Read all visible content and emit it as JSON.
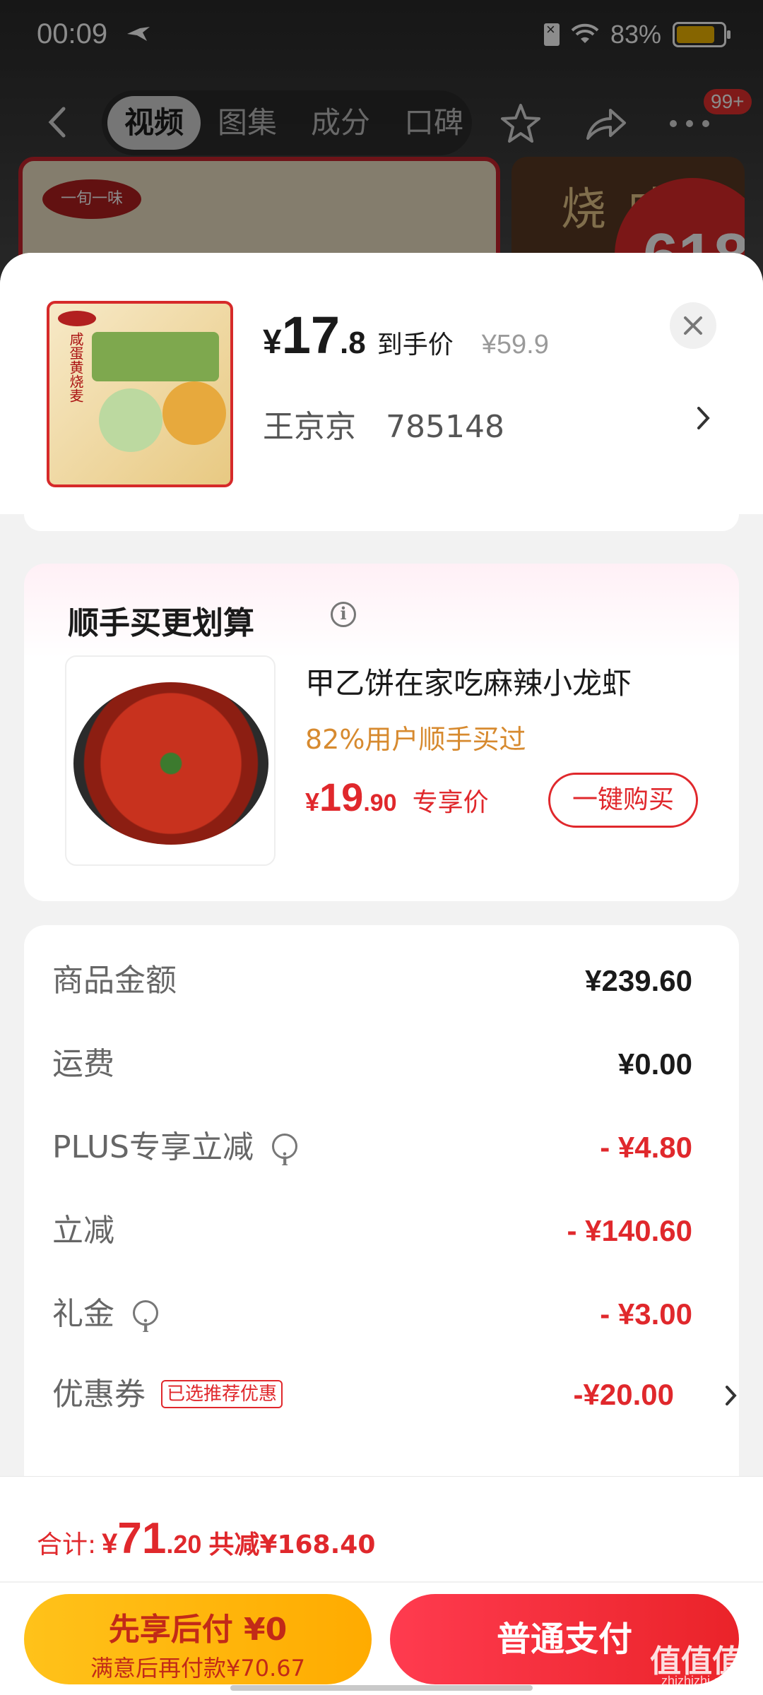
{
  "status_bar": {
    "time": "00:09",
    "battery": "83%",
    "battery_level": 0.83
  },
  "background_page": {
    "tabs": [
      {
        "label": "视频",
        "active": true
      },
      {
        "label": "图集",
        "active": false
      },
      {
        "label": "成分",
        "active": false
      },
      {
        "label": "口碑",
        "active": false
      }
    ],
    "badge": "99+",
    "promo_badge": "618",
    "side_thumb_text": "咸蛋烧",
    "logo_text": "一旬一味"
  },
  "product": {
    "price_symbol": "¥",
    "price_int": "17",
    "price_dec": ".8",
    "price_label": "到手价",
    "original_price": "¥59.9",
    "receiver_name": "王京京",
    "receiver_phone": "785148",
    "thumb_text": "咸蛋黄烧麦"
  },
  "upsell": {
    "title": "顺手买更划算",
    "item_name": "甲乙饼在家吃麻辣小龙虾",
    "social_proof": "82%用户顺手买过",
    "price_symbol": "¥",
    "price_int": "19",
    "price_dec": ".90",
    "price_label": "专享价",
    "buy_button": "一键购买"
  },
  "fees": [
    {
      "label": "商品金额",
      "value": "¥239.60",
      "color": "black",
      "info": false,
      "tag": "",
      "arrow": false
    },
    {
      "label": "运费",
      "value": "¥0.00",
      "color": "black",
      "info": false,
      "tag": "",
      "arrow": false
    },
    {
      "label": "PLUS专享立减",
      "value": "- ¥4.80",
      "color": "red",
      "info": true,
      "tag": "",
      "arrow": false
    },
    {
      "label": "立减",
      "value": "- ¥140.60",
      "color": "red",
      "info": false,
      "tag": "",
      "arrow": false
    },
    {
      "label": "礼金",
      "value": "- ¥3.00",
      "color": "red",
      "info": true,
      "tag": "",
      "arrow": false
    },
    {
      "label": "优惠券",
      "value": "-¥20.00",
      "color": "red",
      "info": false,
      "tag": "已选推荐优惠",
      "arrow": true
    }
  ],
  "totals": {
    "label": "合计:",
    "symbol": "¥",
    "int": "71",
    "dec": ".20",
    "saved": "共减¥168.40"
  },
  "actions": {
    "paylater_title": "先享后付 ¥0",
    "paylater_sub": "满意后再付款¥70.67",
    "pay_button": "普通支付"
  },
  "watermark": {
    "main": "值值值",
    "sub": "zhizhizhi.com"
  },
  "colors": {
    "accent_red": "#e0282c",
    "paylater_yellow": "#ffb800",
    "social_orange": "#d78a2f"
  }
}
